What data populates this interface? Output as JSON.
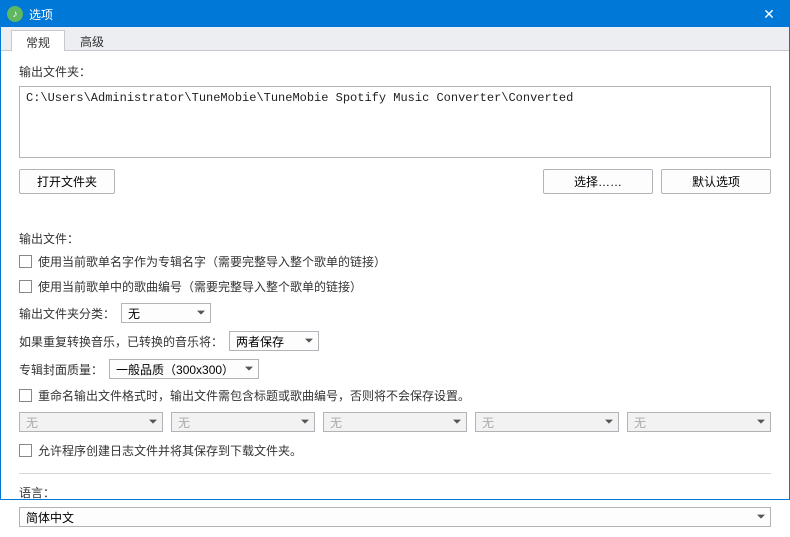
{
  "window": {
    "title": "选项"
  },
  "tabs": {
    "general": "常规",
    "advanced": "高级"
  },
  "outputFolder": {
    "label": "输出文件夹：",
    "path": "C:\\Users\\Administrator\\TuneMobie\\TuneMobie Spotify Music Converter\\Converted",
    "openBtn": "打开文件夹",
    "chooseBtn": "选择……",
    "defaultBtn": "默认选项"
  },
  "outputFile": {
    "label": "输出文件：",
    "usePlaylistAsAlbum": "使用当前歌单名字作为专辑名字（需要完整导入整个歌单的链接）",
    "useTrackNumber": "使用当前歌单中的歌曲编号（需要完整导入整个歌单的链接）",
    "folderCategoryLabel": "输出文件夹分类：",
    "folderCategoryValue": "无",
    "duplicateLabel": "如果重复转换音乐，已转换的音乐将：",
    "duplicateValue": "两者保存",
    "coverQualityLabel": "专辑封面质量：",
    "coverQualityValue": "一般品质（300x300）",
    "renameLabel": "重命名输出文件格式时，输出文件需包含标题或歌曲编号，否则将不会保存设置。",
    "formatNone": "无",
    "allowLog": "允许程序创建日志文件并将其保存到下载文件夹。"
  },
  "language": {
    "label": "语言：",
    "value": "简体中文"
  }
}
